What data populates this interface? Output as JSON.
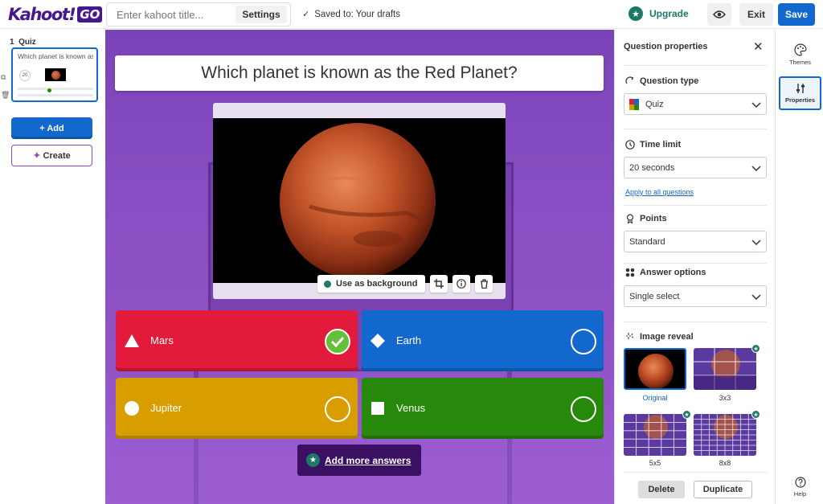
{
  "header": {
    "logo": "Kahoot!",
    "logo_badge": "GO",
    "title_placeholder": "Enter kahoot title...",
    "settings_label": "Settings",
    "saved_status": "Saved to: Your drafts",
    "upgrade_label": "Upgrade",
    "exit_label": "Exit",
    "save_label": "Save"
  },
  "sidebar": {
    "slide_number": "1",
    "slide_type": "Quiz",
    "slide_title": "Which planet is known as the Red Planet?",
    "slide_time": "20",
    "add_label": "Add",
    "create_label": "Create"
  },
  "question": {
    "text": "Which planet is known as the Red Planet?",
    "media_tools": {
      "background_label": "Use as background"
    },
    "answers": [
      {
        "label": "Mars",
        "shape": "triangle",
        "color": "#e21b3c",
        "correct": true
      },
      {
        "label": "Earth",
        "shape": "diamond",
        "color": "#1368ce",
        "correct": false
      },
      {
        "label": "Jupiter",
        "shape": "circle",
        "color": "#d89e00",
        "correct": false
      },
      {
        "label": "Venus",
        "shape": "square",
        "color": "#26890c",
        "correct": false
      }
    ],
    "add_more_label": "Add more answers"
  },
  "properties": {
    "title": "Question properties",
    "question_type": {
      "label": "Question type",
      "value": "Quiz"
    },
    "time_limit": {
      "label": "Time limit",
      "value": "20 seconds",
      "apply_all": "Apply to all questions"
    },
    "points": {
      "label": "Points",
      "value": "Standard"
    },
    "answer_options": {
      "label": "Answer options",
      "value": "Single select"
    },
    "image_reveal": {
      "label": "Image reveal",
      "options": [
        "Original",
        "3x3",
        "5x5",
        "8x8"
      ],
      "selected": "Original"
    },
    "delete_label": "Delete",
    "duplicate_label": "Duplicate"
  },
  "rail": {
    "themes_label": "Themes",
    "properties_label": "Properties",
    "help_label": "Help"
  },
  "colors": {
    "accent": "#1368ce",
    "brand": "#46178f",
    "premium": "#1a7a64"
  }
}
